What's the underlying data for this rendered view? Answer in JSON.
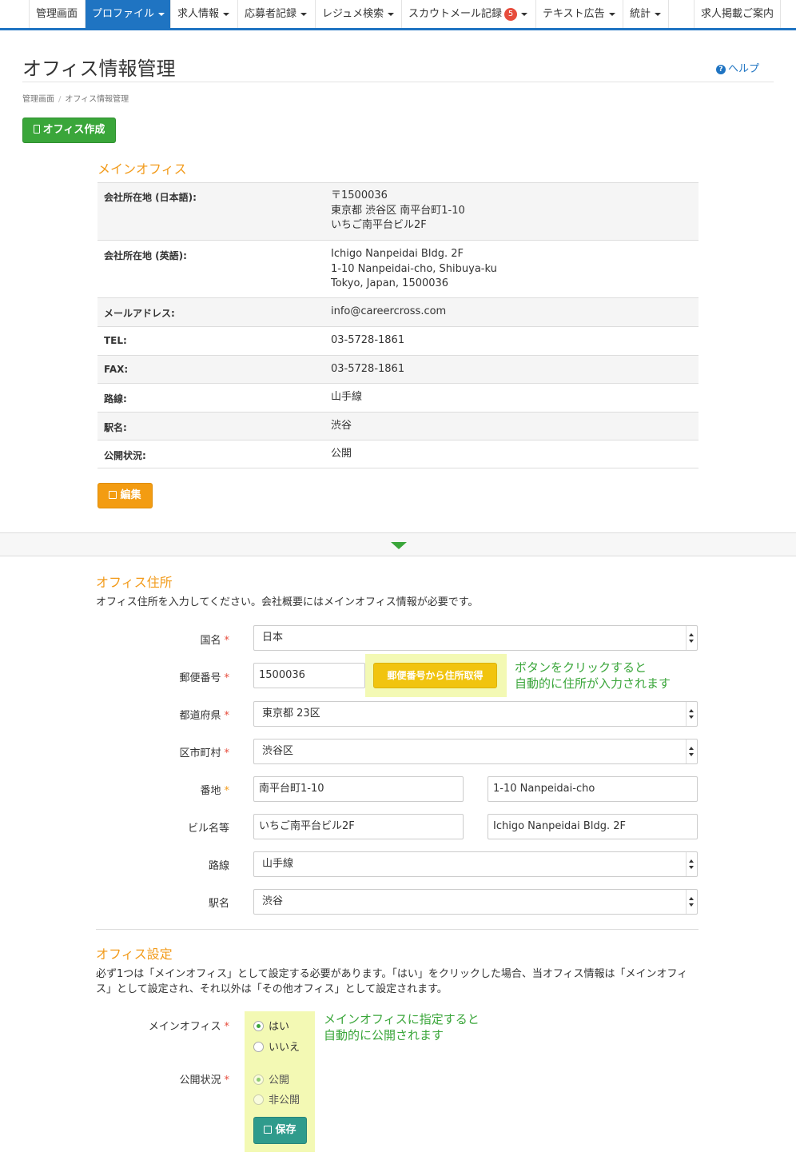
{
  "nav": {
    "items": [
      {
        "label": "管理画面"
      },
      {
        "label": "プロファイル"
      },
      {
        "label": "求人情報"
      },
      {
        "label": "応募者記録"
      },
      {
        "label": "レジュメ検索"
      },
      {
        "label": "スカウトメール記録",
        "badge": "5"
      },
      {
        "label": "テキスト広告"
      },
      {
        "label": "統計"
      },
      {
        "label": "求人掲載ご案内"
      }
    ],
    "active_color": "#1f74c2"
  },
  "page": {
    "title": "オフィス情報管理",
    "help_label": "ヘルプ",
    "breadcrumb": [
      "管理画面",
      "オフィス情報管理"
    ],
    "create_button": "オフィス作成"
  },
  "main_office": {
    "section_title": "メインオフィス",
    "rows": [
      {
        "key": "会社所在地 (日本語):",
        "lines": [
          "〒1500036",
          "東京都 渋谷区 南平台町1-10",
          "いちご南平台ビル2F"
        ]
      },
      {
        "key": "会社所在地 (英語):",
        "lines": [
          "Ichigo Nanpeidai Bldg. 2F",
          "1-10 Nanpeidai-cho, Shibuya-ku",
          "Tokyo, Japan, 1500036"
        ]
      },
      {
        "key": "メールアドレス:",
        "lines": [
          "info@careercross.com"
        ]
      },
      {
        "key": "TEL:",
        "lines": [
          "03-5728-1861"
        ]
      },
      {
        "key": "FAX:",
        "lines": [
          "03-5728-1861"
        ]
      },
      {
        "key": "路線:",
        "lines": [
          "山手線"
        ]
      },
      {
        "key": "駅名:",
        "lines": [
          "渋谷"
        ]
      },
      {
        "key": "公開状況:",
        "lines": [
          "公開"
        ]
      }
    ],
    "edit_button": "編集"
  },
  "address_form": {
    "section_title": "オフィス住所",
    "description": "オフィス住所を入力してください。会社概要にはメインオフィス情報が必要です。",
    "country": {
      "label": "国名",
      "value": "日本"
    },
    "postal": {
      "label": "郵便番号",
      "value": "1500036",
      "button": "郵便番号から住所取得"
    },
    "postal_note": [
      "ボタンをクリックすると",
      "自動的に住所が入力されます"
    ],
    "prefecture": {
      "label": "都道府県",
      "value": "東京都 23区"
    },
    "city": {
      "label": "区市町村",
      "value": "渋谷区"
    },
    "street": {
      "label": "番地",
      "value_ja": "南平台町1-10",
      "value_en": "1-10 Nanpeidai-cho"
    },
    "building": {
      "label": "ビル名等",
      "value_ja": "いちご南平台ビル2F",
      "value_en": "Ichigo Nanpeidai Bldg. 2F"
    },
    "line": {
      "label": "路線",
      "value": "山手線"
    },
    "station": {
      "label": "駅名",
      "value": "渋谷"
    },
    "required_mark": "*"
  },
  "office_settings": {
    "section_title": "オフィス設定",
    "description_lines": [
      "必ず1つは「メインオフィス」として設定する必要があります。「はい」をクリックした場合、当オフィス情報は「メインオフィ",
      "ス」として設定され、それ以外は「その他オフィス」として設定されます。"
    ],
    "main_office": {
      "label": "メインオフィス",
      "options": [
        "はい",
        "いいえ"
      ],
      "selected": "はい"
    },
    "visibility": {
      "label": "公開状況",
      "options": [
        "公開",
        "非公開"
      ],
      "selected": "公開"
    },
    "note": [
      "メインオフィスに指定すると",
      "自動的に公開されます"
    ],
    "save_button": "保存"
  }
}
